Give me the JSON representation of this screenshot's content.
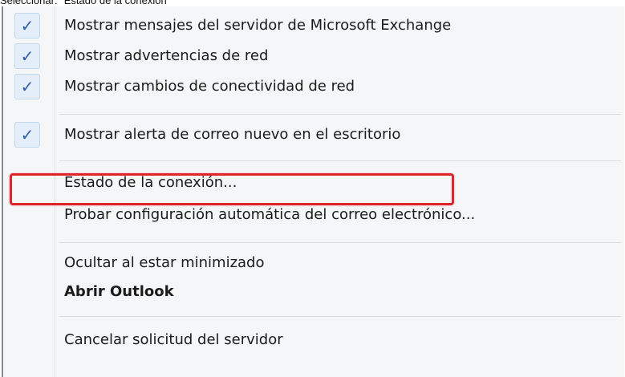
{
  "caption": "Seleccionar: \"Estado de la conexión\"",
  "menu": {
    "items": [
      {
        "label": "Mostrar mensajes del servidor de Microsoft Exchange",
        "checked": true
      },
      {
        "label": "Mostrar advertencias de red",
        "checked": true
      },
      {
        "label": "Mostrar cambios de conectividad de red",
        "checked": true
      },
      {
        "label": "Mostrar alerta de correo nuevo en el escritorio",
        "checked": true
      },
      {
        "label": "Estado de la conexión...",
        "checked": false,
        "highlighted": true
      },
      {
        "label": "Probar configuración automática del correo electrónico...",
        "checked": false
      },
      {
        "label": "Ocultar al estar minimizado",
        "checked": false
      },
      {
        "label": "Abrir Outlook",
        "checked": false,
        "bold": true
      },
      {
        "label": "Cancelar solicitud del servidor",
        "checked": false
      }
    ],
    "check_glyph": "✓"
  },
  "colors": {
    "highlight_border": "#e0242e",
    "checkmark": "#2f5fa8",
    "menu_background": "#f5f6f7"
  }
}
